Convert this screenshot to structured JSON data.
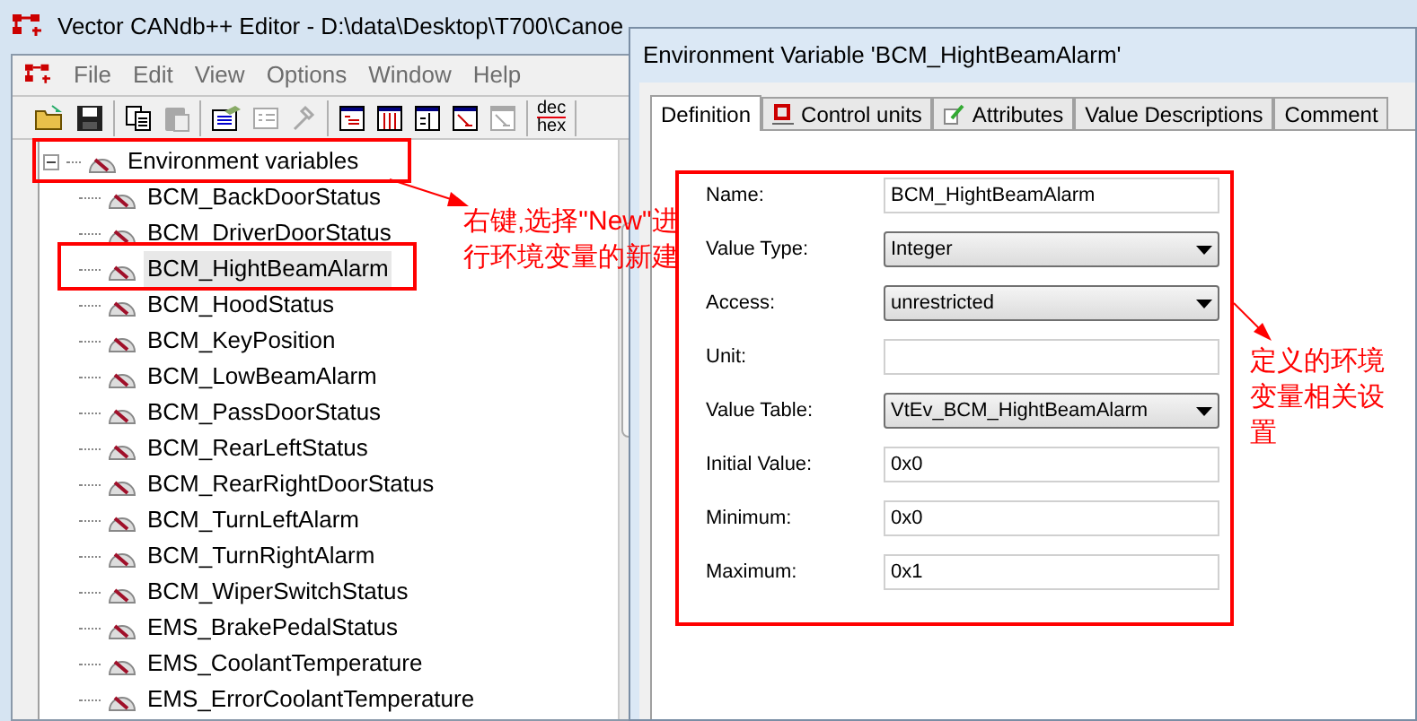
{
  "editor": {
    "title": "Vector CANdb++ Editor - D:\\data\\Desktop\\T700\\Canoe",
    "menu": [
      {
        "label": "File"
      },
      {
        "label": "Edit"
      },
      {
        "label": "View"
      },
      {
        "label": "Options"
      },
      {
        "label": "Window"
      },
      {
        "label": "Help"
      }
    ],
    "toolbar": [
      [
        {
          "kind": "open",
          "disabled": false
        },
        {
          "kind": "save",
          "disabled": false
        }
      ],
      [
        {
          "kind": "copy",
          "disabled": false
        },
        {
          "kind": "paste",
          "disabled": true
        }
      ],
      [
        {
          "kind": "properties",
          "disabled": false
        },
        {
          "kind": "form",
          "disabled": true
        },
        {
          "kind": "wrench",
          "disabled": true
        }
      ],
      [
        {
          "kind": "list",
          "disabled": false
        },
        {
          "kind": "columns",
          "disabled": false
        },
        {
          "kind": "split",
          "disabled": false
        },
        {
          "kind": "chart",
          "disabled": false
        },
        {
          "kind": "chart",
          "disabled": true
        }
      ],
      [
        {
          "kind": "dechex",
          "disabled": false,
          "top": "dec",
          "bottom": "hex"
        }
      ]
    ],
    "tree": {
      "label": "Environment variables",
      "expanded": true,
      "children": [
        {
          "label": "BCM_BackDoorStatus",
          "selected": false
        },
        {
          "label": "BCM_DriverDoorStatus",
          "selected": false
        },
        {
          "label": "BCM_HightBeamAlarm",
          "selected": true
        },
        {
          "label": "BCM_HoodStatus",
          "selected": false
        },
        {
          "label": "BCM_KeyPosition",
          "selected": false
        },
        {
          "label": "BCM_LowBeamAlarm",
          "selected": false
        },
        {
          "label": "BCM_PassDoorStatus",
          "selected": false
        },
        {
          "label": "BCM_RearLeftStatus",
          "selected": false
        },
        {
          "label": "BCM_RearRightDoorStatus",
          "selected": false
        },
        {
          "label": "BCM_TurnLeftAlarm",
          "selected": false
        },
        {
          "label": "BCM_TurnRightAlarm",
          "selected": false
        },
        {
          "label": "BCM_WiperSwitchStatus",
          "selected": false
        },
        {
          "label": "EMS_BrakePedalStatus",
          "selected": false
        },
        {
          "label": "EMS_CoolantTemperature",
          "selected": false
        },
        {
          "label": "EMS_ErrorCoolantTemperature",
          "selected": false
        }
      ]
    }
  },
  "dialog": {
    "title": "Environment Variable 'BCM_HightBeamAlarm'",
    "tabs": [
      {
        "label": "Definition",
        "selected": true,
        "kind": "plain"
      },
      {
        "label": "Control units",
        "selected": false,
        "kind": "ecu"
      },
      {
        "label": "Attributes",
        "selected": false,
        "kind": "pencil"
      },
      {
        "label": "Value Descriptions",
        "selected": false,
        "kind": "plain"
      },
      {
        "label": "Comment",
        "selected": false,
        "kind": "plain"
      }
    ],
    "fields": [
      {
        "label": "Name:",
        "kind": "text",
        "value": "BCM_HightBeamAlarm"
      },
      {
        "label": "Value Type:",
        "kind": "select",
        "value": "Integer"
      },
      {
        "label": "Access:",
        "kind": "select",
        "value": "unrestricted"
      },
      {
        "label": "Unit:",
        "kind": "text"
      },
      {
        "label": "Value Table:",
        "kind": "select",
        "value": "VtEv_BCM_HightBeamAlarm"
      },
      {
        "label": "Initial Value:",
        "kind": "text",
        "value": "0x0"
      },
      {
        "label": "Minimum:",
        "kind": "text",
        "value": "0x0"
      },
      {
        "label": "Maximum:",
        "kind": "text",
        "value": "0x1"
      }
    ]
  },
  "annotations": [
    {
      "lines": [
        "右键,选择\"New\"进",
        "行环境变量的新建"
      ]
    },
    {
      "lines": [
        "定义的环境",
        "变量相关设",
        "置"
      ]
    }
  ]
}
